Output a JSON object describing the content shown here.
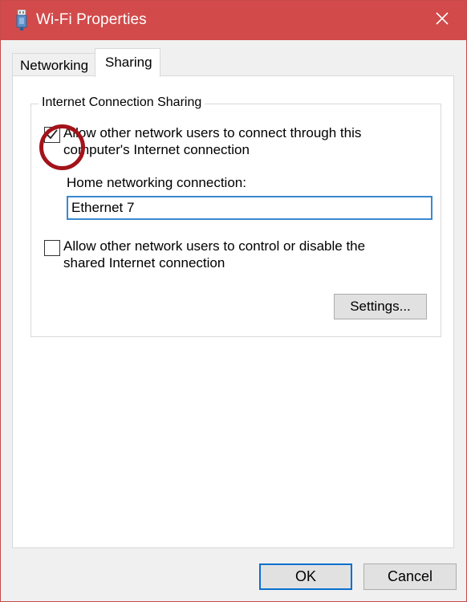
{
  "window": {
    "title": "Wi-Fi Properties",
    "title_icon": "wifi-adapter-icon",
    "close_icon": "close-icon",
    "titlebar_color": "#d24a4a"
  },
  "tabs": [
    {
      "label": "Networking",
      "selected": false
    },
    {
      "label": "Sharing",
      "selected": true
    }
  ],
  "sharing": {
    "group_title": "Internet Connection Sharing",
    "allow_connect": {
      "label": "Allow other network users to connect through this computer's Internet connection",
      "checked": true
    },
    "home_connection": {
      "label": "Home networking connection:",
      "value": "Ethernet 7"
    },
    "allow_control": {
      "label": "Allow other network users to control or disable the shared Internet connection",
      "checked": false
    },
    "settings_label": "Settings..."
  },
  "footer": {
    "ok_label": "OK",
    "cancel_label": "Cancel"
  },
  "annotation": {
    "shape": "circle",
    "color": "#a3131a",
    "target": "allow_connect checkbox"
  }
}
